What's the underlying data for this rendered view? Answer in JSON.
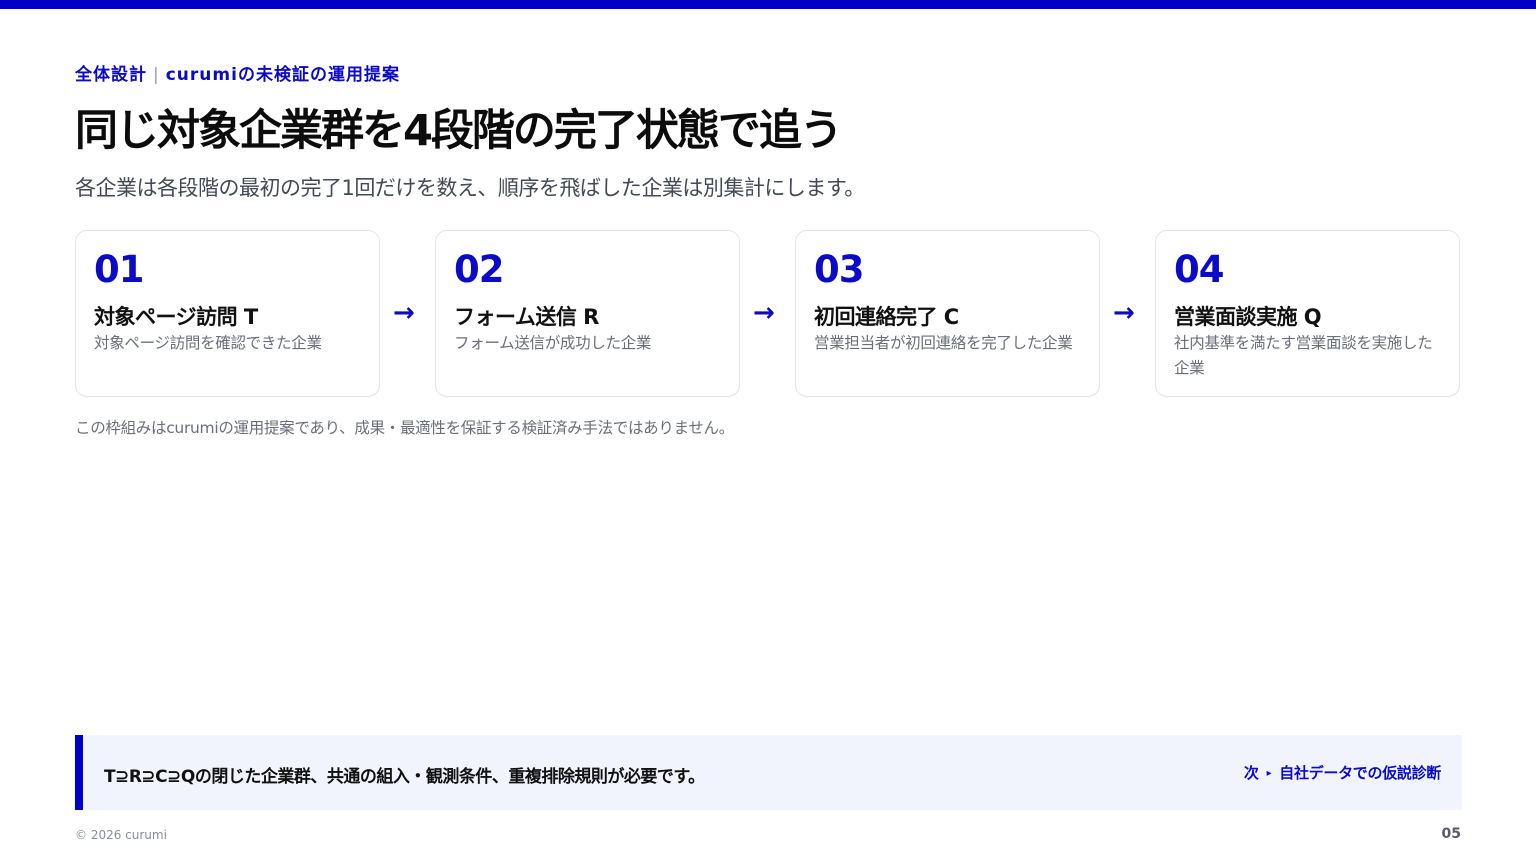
{
  "header": {
    "eyebrow_section": "全体設計",
    "eyebrow_separator": "|",
    "eyebrow_topic": "curumiの未検証の運用提案",
    "title": "同じ対象企業群を4段階の完了状態で追う",
    "subtitle": "各企業は各段階の最初の完了1回だけを数え、順序を飛ばした企業は別集計にします。"
  },
  "stages": [
    {
      "number": "01",
      "name": "対象ページ訪問 T",
      "description": "対象ページ訪問を確認できた企業"
    },
    {
      "number": "02",
      "name": "フォーム送信 R",
      "description": "フォーム送信が成功した企業"
    },
    {
      "number": "03",
      "name": "初回連絡完了 C",
      "description": "営業担当者が初回連絡を完了した企業"
    },
    {
      "number": "04",
      "name": "営業面談実施 Q",
      "description": "社内基準を満たす営業面談を実施した企業"
    }
  ],
  "arrow_glyph": "→",
  "note": "この枠組みはcurumiの運用提案であり、成果・最適性を保証する検証済み手法ではありません。",
  "callout": {
    "text": "T⊇R⊇C⊇Qの閉じた企業群、共通の組入・観測条件、重複排除規則が必要です。",
    "next_prefix": "次",
    "next_marker": "▸",
    "next_label": "自社データでの仮説診断"
  },
  "footer": {
    "copyright": "© 2026 curumi",
    "page_number": "05"
  },
  "colors": {
    "accent": "#0000c8",
    "callout_background": "#f1f4fc",
    "muted_text": "#6b6f7a"
  }
}
